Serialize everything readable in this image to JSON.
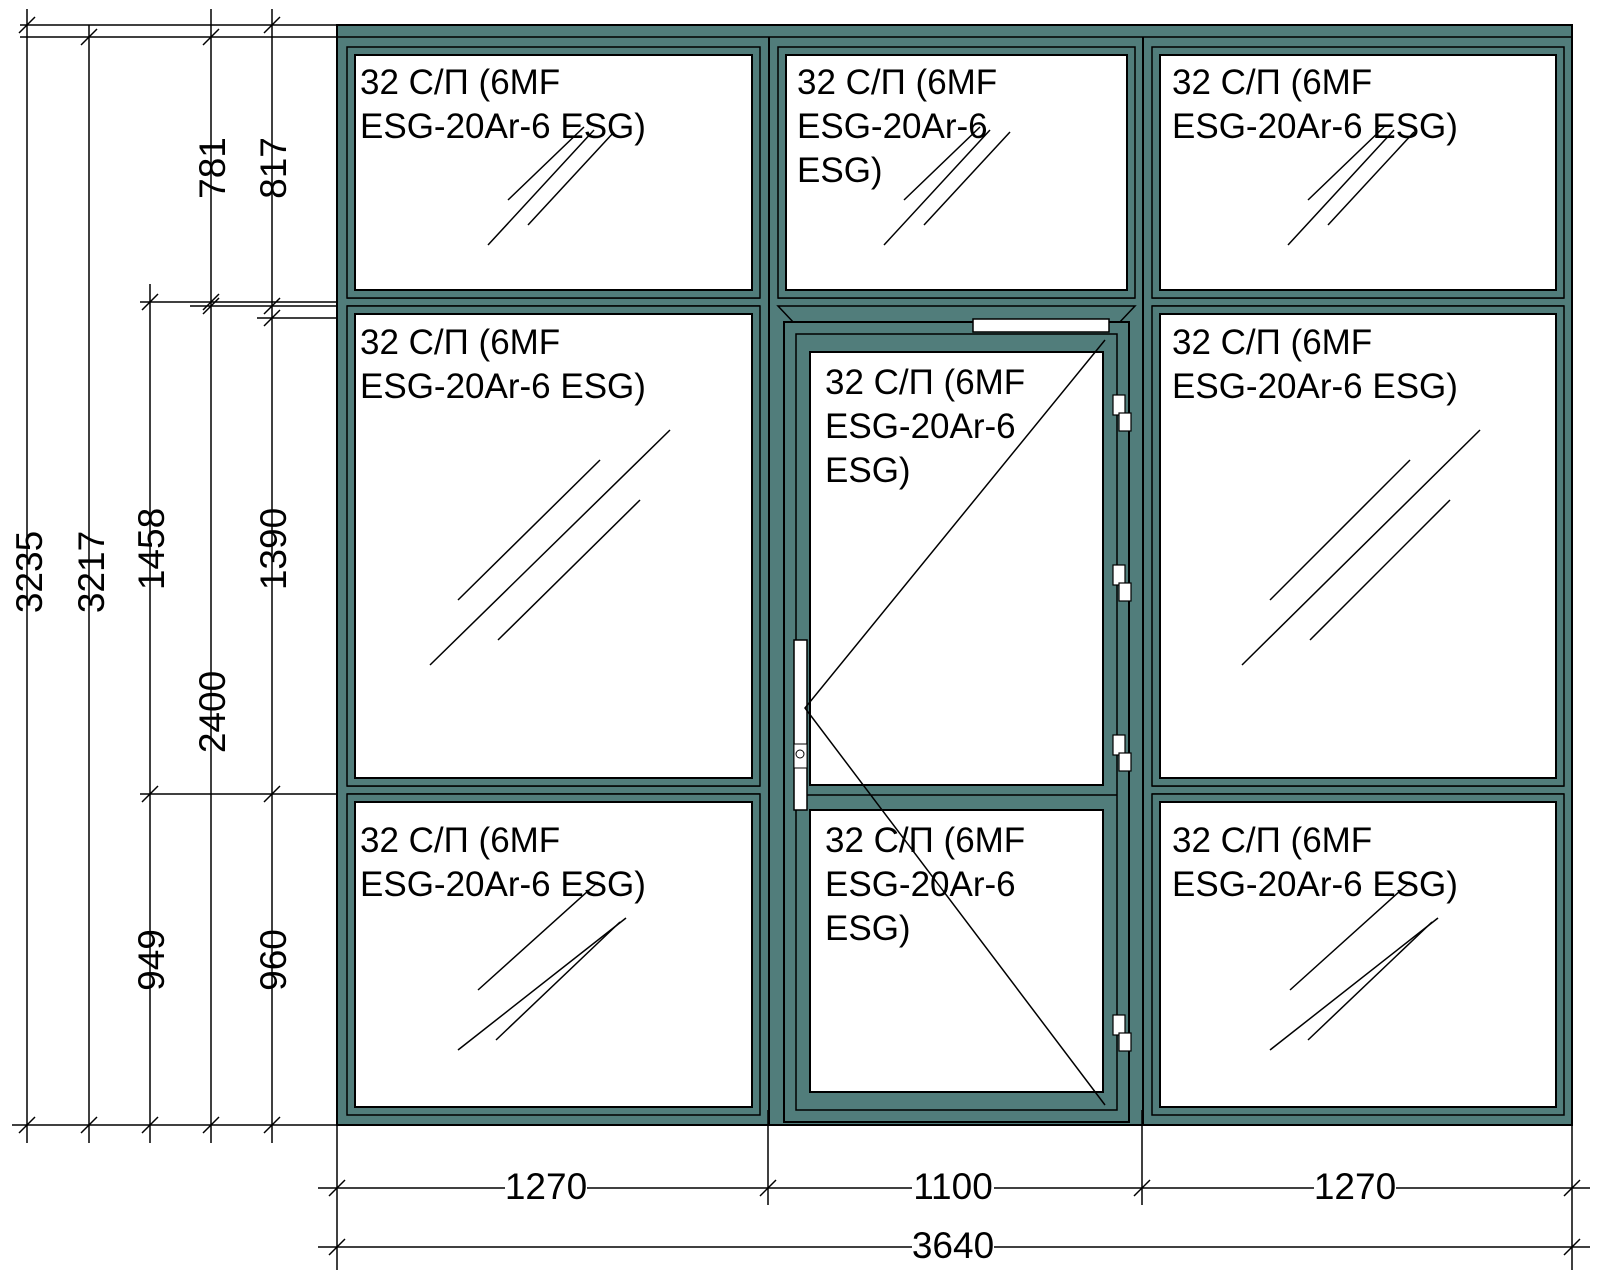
{
  "colors": {
    "frame": "#517d7b",
    "line": "#000000",
    "glass": "#ffffff"
  },
  "vertical_dims": {
    "total": "3235",
    "frame_height": "3217",
    "middle_left": "1458",
    "bottom_left": "949",
    "door_height": "2400",
    "top_right": "781",
    "top_outer": "817",
    "middle_right": "1390",
    "bottom_right": "960"
  },
  "horizontal_dims": {
    "left": "1270",
    "center": "1100",
    "right": "1270",
    "total": "3640"
  },
  "glass": {
    "top_left": [
      "32 С/П (6MF",
      "ESG-20Ar-6 ESG)"
    ],
    "top_center": [
      "32 С/П (6MF",
      "ESG-20Ar-6",
      "ESG)"
    ],
    "top_right": [
      "32 С/П (6MF",
      "ESG-20Ar-6 ESG)"
    ],
    "mid_left": [
      "32 С/П (6MF",
      "ESG-20Ar-6 ESG)"
    ],
    "door_upper": [
      "32 С/П (6MF",
      "ESG-20Ar-6",
      "ESG)"
    ],
    "mid_right": [
      "32 С/П (6MF",
      "ESG-20Ar-6 ESG)"
    ],
    "bot_left": [
      "32 С/П (6MF",
      "ESG-20Ar-6 ESG)"
    ],
    "door_lower": [
      "32 С/П (6MF",
      "ESG-20Ar-6",
      "ESG)"
    ],
    "bot_right": [
      "32 С/П (6MF",
      "ESG-20Ar-6 ESG)"
    ]
  }
}
